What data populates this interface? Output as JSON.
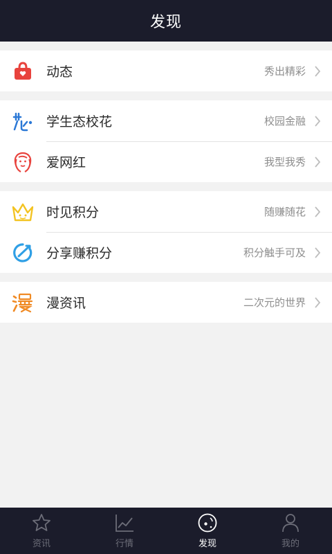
{
  "header": {
    "title": "发现"
  },
  "groups": [
    {
      "items": [
        {
          "icon": "gift-bag-icon",
          "label": "动态",
          "sub": "秀出精彩"
        }
      ]
    },
    {
      "items": [
        {
          "icon": "flower-logo-icon",
          "label": "学生态校花",
          "sub": "校园金融"
        },
        {
          "icon": "woman-face-icon",
          "label": "爱网红",
          "sub": "我型我秀"
        }
      ]
    },
    {
      "items": [
        {
          "icon": "crown-icon",
          "label": "时见积分",
          "sub": "随赚随花"
        },
        {
          "icon": "share-circle-icon",
          "label": "分享赚积分",
          "sub": "积分触手可及"
        }
      ]
    },
    {
      "items": [
        {
          "icon": "manga-icon",
          "label": "漫资讯",
          "sub": "二次元的世界"
        }
      ]
    }
  ],
  "tabs": [
    {
      "icon": "star-icon",
      "label": "资讯",
      "active": false
    },
    {
      "icon": "chart-icon",
      "label": "行情",
      "active": false
    },
    {
      "icon": "discover-icon",
      "label": "发现",
      "active": true
    },
    {
      "icon": "person-icon",
      "label": "我的",
      "active": false
    }
  ],
  "colors": {
    "header_bg": "#1b1c2b",
    "page_bg": "#f2f2f2"
  }
}
